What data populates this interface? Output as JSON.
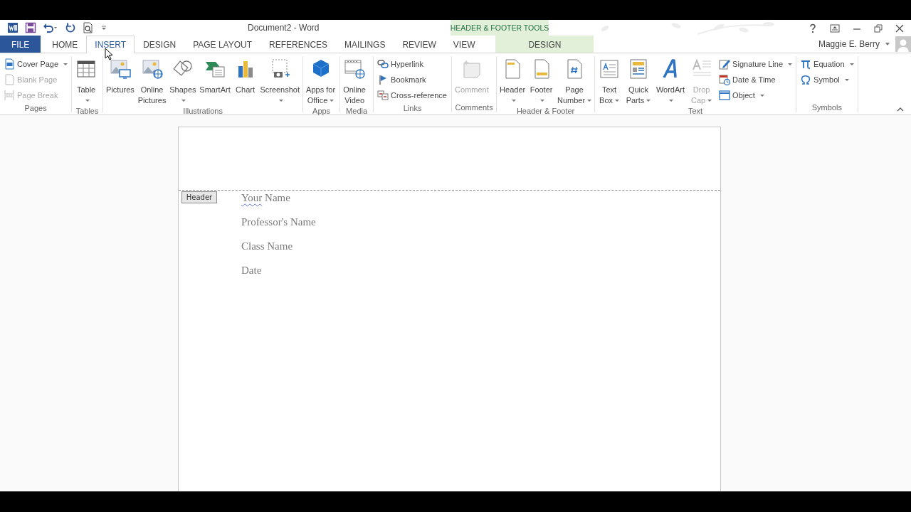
{
  "window": {
    "title": "Document2 - Word",
    "contextual_label": "HEADER & FOOTER TOOLS",
    "user": "Maggie E. Berry"
  },
  "tabs": [
    {
      "label": "FILE",
      "kind": "file",
      "selected": false
    },
    {
      "label": "HOME",
      "kind": "normal",
      "selected": false
    },
    {
      "label": "INSERT",
      "kind": "normal",
      "selected": true
    },
    {
      "label": "DESIGN",
      "kind": "normal",
      "selected": false
    },
    {
      "label": "PAGE LAYOUT",
      "kind": "normal",
      "selected": false
    },
    {
      "label": "REFERENCES",
      "kind": "normal",
      "selected": false
    },
    {
      "label": "MAILINGS",
      "kind": "normal",
      "selected": false
    },
    {
      "label": "REVIEW",
      "kind": "normal",
      "selected": false
    },
    {
      "label": "VIEW",
      "kind": "normal",
      "selected": false
    },
    {
      "label": "DESIGN",
      "kind": "contextual",
      "selected": false
    }
  ],
  "ribbon": {
    "groups": [
      {
        "label": "Pages",
        "items": [
          {
            "kind": "small",
            "lines": [
              "Cover Page"
            ],
            "dropdown": true,
            "disabled": false
          },
          {
            "kind": "small",
            "lines": [
              "Blank Page"
            ],
            "dropdown": false,
            "disabled": true
          },
          {
            "kind": "small",
            "lines": [
              "Page Break"
            ],
            "dropdown": false,
            "disabled": true
          }
        ]
      },
      {
        "label": "Tables",
        "items": [
          {
            "kind": "large",
            "lines": [
              "Table"
            ],
            "dropdown": true,
            "disabled": false
          }
        ]
      },
      {
        "label": "Illustrations",
        "items": [
          {
            "kind": "large",
            "lines": [
              "Pictures"
            ],
            "dropdown": false,
            "disabled": false
          },
          {
            "kind": "large",
            "lines": [
              "Online",
              "Pictures"
            ],
            "dropdown": false,
            "disabled": false
          },
          {
            "kind": "large",
            "lines": [
              "Shapes"
            ],
            "dropdown": true,
            "disabled": false
          },
          {
            "kind": "large",
            "lines": [
              "SmartArt"
            ],
            "dropdown": false,
            "disabled": false
          },
          {
            "kind": "large",
            "lines": [
              "Chart"
            ],
            "dropdown": false,
            "disabled": false
          },
          {
            "kind": "large",
            "lines": [
              "Screenshot"
            ],
            "dropdown": true,
            "disabled": false
          }
        ]
      },
      {
        "label": "Apps",
        "items": [
          {
            "kind": "large",
            "lines": [
              "Apps for",
              "Office"
            ],
            "dropdown": true,
            "disabled": false
          }
        ]
      },
      {
        "label": "Media",
        "items": [
          {
            "kind": "large",
            "lines": [
              "Online",
              "Video"
            ],
            "dropdown": false,
            "disabled": false
          }
        ]
      },
      {
        "label": "Links",
        "items": [
          {
            "kind": "small",
            "lines": [
              "Hyperlink"
            ],
            "dropdown": false,
            "disabled": false
          },
          {
            "kind": "small",
            "lines": [
              "Bookmark"
            ],
            "dropdown": false,
            "disabled": false
          },
          {
            "kind": "small",
            "lines": [
              "Cross-reference"
            ],
            "dropdown": false,
            "disabled": false
          }
        ]
      },
      {
        "label": "Comments",
        "items": [
          {
            "kind": "large",
            "lines": [
              "Comment"
            ],
            "dropdown": false,
            "disabled": true
          }
        ]
      },
      {
        "label": "Header & Footer",
        "items": [
          {
            "kind": "large",
            "lines": [
              "Header"
            ],
            "dropdown": true,
            "disabled": false
          },
          {
            "kind": "large",
            "lines": [
              "Footer"
            ],
            "dropdown": true,
            "disabled": false
          },
          {
            "kind": "large",
            "lines": [
              "Page",
              "Number"
            ],
            "dropdown": true,
            "disabled": false
          }
        ]
      },
      {
        "label": "Text",
        "items": [
          {
            "kind": "large",
            "lines": [
              "Text",
              "Box"
            ],
            "dropdown": true,
            "disabled": false
          },
          {
            "kind": "large",
            "lines": [
              "Quick",
              "Parts"
            ],
            "dropdown": true,
            "disabled": false
          },
          {
            "kind": "large",
            "lines": [
              "WordArt"
            ],
            "dropdown": true,
            "disabled": false
          },
          {
            "kind": "large",
            "lines": [
              "Drop",
              "Cap"
            ],
            "dropdown": true,
            "disabled": true
          },
          {
            "kind": "small",
            "lines": [
              "Signature Line"
            ],
            "dropdown": true,
            "disabled": false
          },
          {
            "kind": "small",
            "lines": [
              "Date & Time"
            ],
            "dropdown": false,
            "disabled": false
          },
          {
            "kind": "small",
            "lines": [
              "Object"
            ],
            "dropdown": true,
            "disabled": false
          }
        ]
      },
      {
        "label": "Symbols",
        "items": [
          {
            "kind": "small",
            "lines": [
              "Equation"
            ],
            "dropdown": true,
            "disabled": false
          },
          {
            "kind": "small",
            "lines": [
              "Symbol"
            ],
            "dropdown": true,
            "disabled": false
          }
        ]
      }
    ]
  },
  "document": {
    "header_tag": "Header",
    "header_lines": [
      {
        "segments": [
          {
            "text": "Your",
            "flagged": true
          },
          {
            "text": " Name",
            "flagged": false
          }
        ]
      },
      {
        "segments": [
          {
            "text": "Professor's Name",
            "flagged": false
          }
        ]
      },
      {
        "segments": [
          {
            "text": "Class Name",
            "flagged": false
          }
        ]
      },
      {
        "segments": [
          {
            "text": "Date",
            "flagged": false
          }
        ]
      }
    ]
  }
}
